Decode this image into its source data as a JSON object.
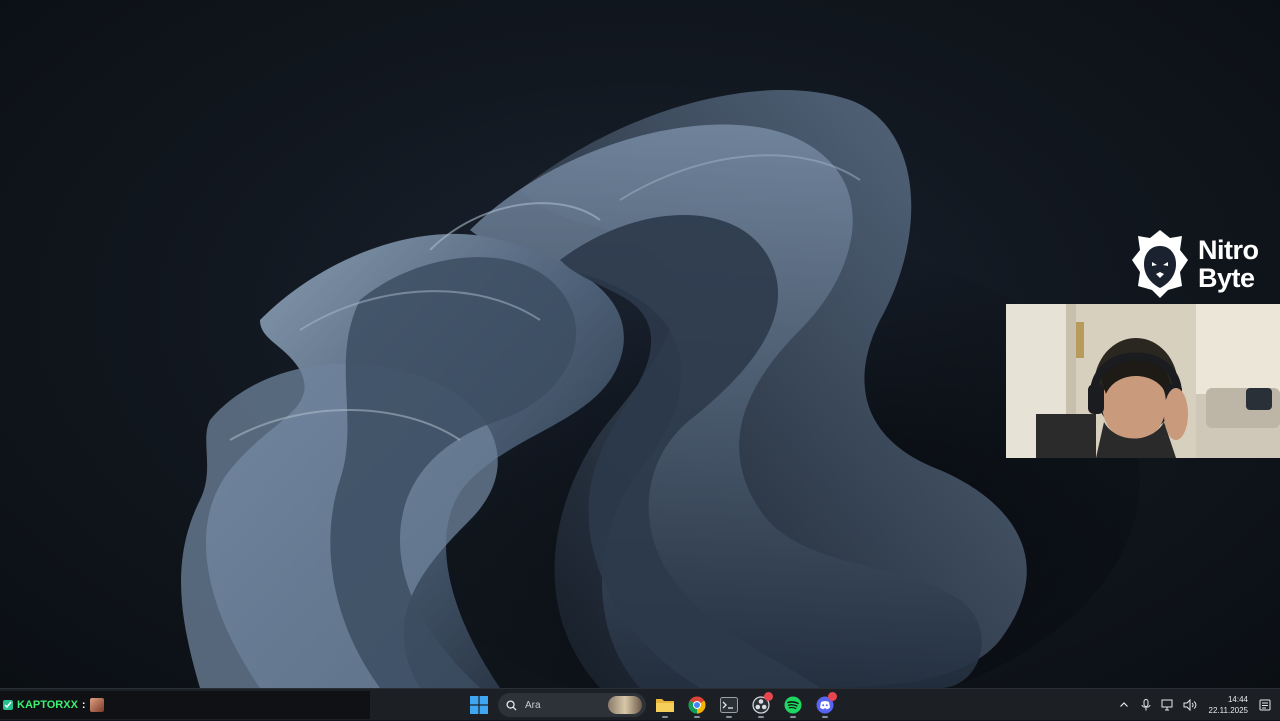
{
  "overlay": {
    "brand_line1": "Nitro",
    "brand_line2": "Byte",
    "chat_user": "KAPTORXX",
    "chat_separator": ":"
  },
  "taskbar": {
    "start_icon": "windows-start-icon",
    "search_icon": "search-icon",
    "search_placeholder": "Ara",
    "apps": [
      {
        "name": "file-explorer",
        "icon": "folder-icon",
        "running": true
      },
      {
        "name": "chrome",
        "icon": "chrome-icon",
        "running": true
      },
      {
        "name": "terminal",
        "icon": "terminal-icon",
        "running": true
      },
      {
        "name": "obs",
        "icon": "obs-icon",
        "running": true,
        "badge": true
      },
      {
        "name": "spotify",
        "icon": "spotify-icon",
        "running": true
      },
      {
        "name": "discord",
        "icon": "discord-icon",
        "running": true,
        "badge": true
      }
    ],
    "tray_icons": [
      "chevron-up-icon",
      "microphone-icon",
      "network-icon",
      "volume-icon"
    ],
    "clock": {
      "time": "14:44",
      "date": "22.11.2025"
    },
    "notification_icon": "notification-icon"
  },
  "colors": {
    "taskbar_bg": "#1c1f24",
    "accent_blue": "#3fa6f2",
    "spotify_green": "#1ed760",
    "discord_blurple": "#5865f2",
    "chat_user_green": "#3cf070"
  }
}
